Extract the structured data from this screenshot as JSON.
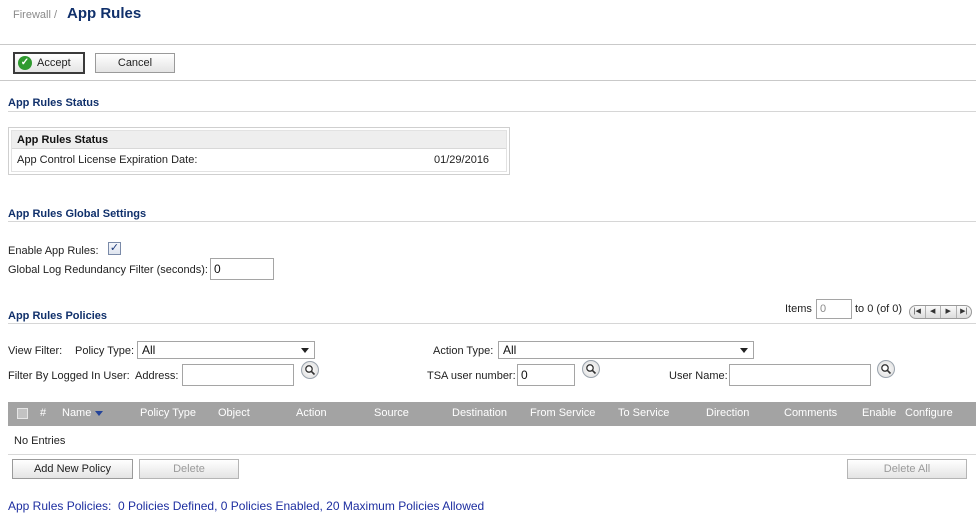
{
  "header": {
    "breadcrumb": "Firewall /",
    "title": "App Rules"
  },
  "toolbar": {
    "accept_label": "Accept",
    "cancel_label": "Cancel"
  },
  "status_section": {
    "heading": "App Rules Status",
    "box_title": "App Rules Status",
    "license_label": "App Control License Expiration Date:",
    "license_value": "01/29/2016"
  },
  "global_settings": {
    "heading": "App Rules Global Settings",
    "enable_label": "Enable App Rules:",
    "enable_checked": true,
    "redundancy_label": "Global Log Redundancy Filter (seconds):",
    "redundancy_value": "0"
  },
  "policies": {
    "heading": "App Rules Policies",
    "items_label": "Items",
    "items_value": "0",
    "items_range": "to 0 (of 0)",
    "pager_icons": [
      "first-page-icon",
      "prev-page-icon",
      "next-page-icon",
      "last-page-icon"
    ],
    "view_filter_label": "View Filter:",
    "policy_type_label": "Policy Type:",
    "policy_type_value": "All",
    "action_type_label": "Action Type:",
    "action_type_value": "All",
    "filter_logged_label": "Filter By Logged In User:",
    "address_label": "Address:",
    "address_value": "",
    "tsa_label": "TSA user number:",
    "tsa_value": "0",
    "username_label": "User Name:",
    "username_value": ""
  },
  "table": {
    "columns": [
      "#",
      "Name",
      "Policy Type",
      "Object",
      "Action",
      "Source",
      "Destination",
      "From Service",
      "To Service",
      "Direction",
      "Comments",
      "Enable",
      "Configure"
    ],
    "empty_text": "No Entries"
  },
  "table_actions": {
    "add_label": "Add New Policy",
    "delete_label": "Delete",
    "delete_all_label": "Delete All"
  },
  "footer": {
    "summary": "App Rules Policies:  0 Policies Defined, 0 Policies Enabled, 20 Maximum Policies Allowed"
  },
  "colors": {
    "heading_blue": "#10306b",
    "table_header_gray": "#a3a3a3",
    "footer_blue": "#1d2ea0",
    "accept_icon_green": "#2f9a2f"
  }
}
